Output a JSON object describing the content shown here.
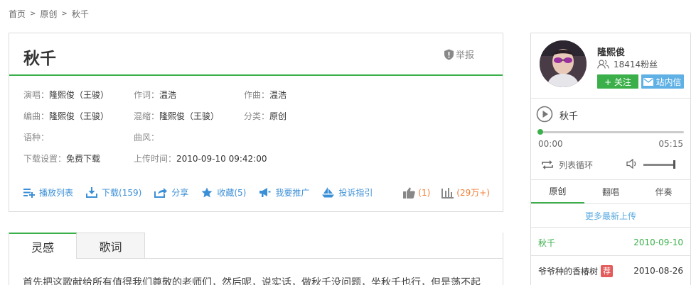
{
  "breadcrumb": {
    "items": [
      "首页",
      "原创",
      "秋千"
    ],
    "separator": ">"
  },
  "song": {
    "title": "秋千",
    "report_label": "举报",
    "info": {
      "singer_label": "演唱：",
      "singer": "隆熙俊（王骏）",
      "lyricist_label": "作词：",
      "lyricist": "温浩",
      "composer_label": "作曲：",
      "composer": "温浩",
      "arranger_label": "编曲：",
      "arranger": "隆熙俊（王骏）",
      "mixer_label": "混缩：",
      "mixer": "隆熙俊（王骏）",
      "category_label": "分类：",
      "category": "原创",
      "language_label": "语种：",
      "language": "",
      "style_label": "曲风：",
      "style": "",
      "download_label": "下载设置：",
      "download": "免费下载",
      "upload_label": "上传时间：",
      "upload": "2010-09-10 09:42:00"
    },
    "actions": {
      "playlist": "播放列表",
      "download": "下载(159)",
      "share": "分享",
      "favorite": "收藏(5)",
      "promote": "我要推广",
      "complaint": "投诉指引"
    },
    "stats": {
      "likes": "(1)",
      "plays": "(29万+)"
    }
  },
  "content_tabs": {
    "tabs": [
      "灵感",
      "歌词"
    ],
    "active": 0,
    "intro": "首先把这歌献给所有值得我们尊敬的老师们，然后呢，说实话，做秋千没问题，坐秋千也行，但是荡不起"
  },
  "artist": {
    "name": "隆熙俊",
    "fans": "18414粉丝",
    "follow_label": "+ 关注",
    "message_label": "站内信"
  },
  "player": {
    "track": "秋千",
    "current_time": "00:00",
    "total_time": "05:15",
    "progress": 0.0,
    "loop_label": "列表循环",
    "volume": 0.95
  },
  "sidebar_tabs": {
    "tabs": [
      "原创",
      "翻唱",
      "伴奏"
    ],
    "active": 0,
    "more_label": "更多最新上传",
    "songs": [
      {
        "name": "秋千",
        "date": "2010-09-10",
        "highlight": true,
        "recommended": false
      },
      {
        "name": "爷爷种的香椿树",
        "date": "2010-08-26",
        "highlight": false,
        "recommended": true,
        "badge": "荐"
      }
    ]
  },
  "colors": {
    "accent_green": "#3bb04a",
    "link_blue": "#3b8fd6",
    "stat_orange": "#f07e35",
    "badge_red": "#e45b5b",
    "msg_blue": "#5fb0e4"
  }
}
